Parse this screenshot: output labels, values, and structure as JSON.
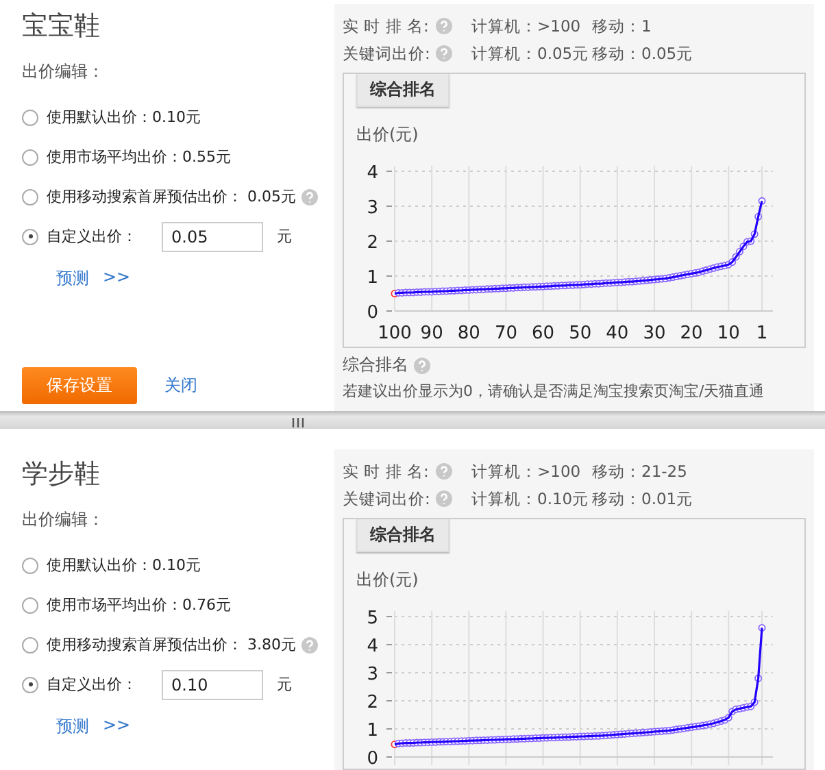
{
  "panels": [
    {
      "title": "宝宝鞋",
      "bid_label": "出价编辑：",
      "options": [
        {
          "kind": "preset",
          "label": "使用默认出价：0.10元",
          "selected": false,
          "help": false
        },
        {
          "kind": "preset",
          "label": "使用市场平均出价：0.55元",
          "selected": false,
          "help": false
        },
        {
          "kind": "preset",
          "label": "使用移动搜索首屏预估出价： 0.05元",
          "selected": false,
          "help": true
        },
        {
          "kind": "custom",
          "label": "自定义出价：",
          "value": "0.05",
          "unit": "元",
          "selected": true,
          "help": false
        }
      ],
      "forecast_link": "预测",
      "forecast_arrow": ">>",
      "save_button": "保存设置",
      "close_link": "关闭",
      "stats": [
        {
          "label": "实 时 排 名:",
          "computer": "计算机：>100",
          "mobile": "移动：1"
        },
        {
          "label": "关键词出价:",
          "computer": "计算机：0.05元",
          "mobile": "移动：0.05元"
        }
      ],
      "chart": {
        "tab": "综合排名",
        "y_title": "出价(元)",
        "chart_data": {
          "type": "line",
          "grid": true,
          "ylim": [
            0,
            4
          ],
          "yticks": [
            0,
            1,
            2,
            3,
            4
          ],
          "xlim": [
            100,
            1
          ],
          "xticks": [
            100,
            90,
            80,
            70,
            60,
            50,
            40,
            30,
            20,
            10,
            1
          ],
          "x": [
            100,
            99,
            98,
            97,
            96,
            95,
            94,
            93,
            92,
            91,
            90,
            89,
            88,
            87,
            86,
            85,
            84,
            83,
            82,
            81,
            80,
            79,
            78,
            77,
            76,
            75,
            74,
            73,
            72,
            71,
            70,
            69,
            68,
            67,
            66,
            65,
            64,
            63,
            62,
            61,
            60,
            59,
            58,
            57,
            56,
            55,
            54,
            53,
            52,
            51,
            50,
            49,
            48,
            47,
            46,
            45,
            44,
            43,
            42,
            41,
            40,
            39,
            38,
            37,
            36,
            35,
            34,
            33,
            32,
            31,
            30,
            29,
            28,
            27,
            26,
            25,
            24,
            23,
            22,
            21,
            20,
            19,
            18,
            17,
            16,
            15,
            14,
            13,
            12,
            11,
            10,
            9,
            8,
            7,
            6,
            5,
            4,
            3,
            2,
            1
          ],
          "series": [
            {
              "color": "#2200ff",
              "marker": "circle",
              "values": [
                0.5,
                0.52,
                0.52,
                0.53,
                0.53,
                0.53,
                0.54,
                0.54,
                0.55,
                0.55,
                0.55,
                0.56,
                0.56,
                0.57,
                0.57,
                0.58,
                0.58,
                0.59,
                0.59,
                0.6,
                0.6,
                0.61,
                0.61,
                0.62,
                0.62,
                0.63,
                0.63,
                0.64,
                0.64,
                0.65,
                0.65,
                0.66,
                0.66,
                0.67,
                0.67,
                0.68,
                0.68,
                0.69,
                0.69,
                0.7,
                0.7,
                0.71,
                0.71,
                0.72,
                0.72,
                0.73,
                0.73,
                0.74,
                0.74,
                0.75,
                0.75,
                0.76,
                0.77,
                0.77,
                0.78,
                0.78,
                0.79,
                0.8,
                0.8,
                0.81,
                0.82,
                0.82,
                0.83,
                0.84,
                0.84,
                0.85,
                0.86,
                0.87,
                0.88,
                0.89,
                0.9,
                0.91,
                0.92,
                0.93,
                0.95,
                0.97,
                0.99,
                1.01,
                1.03,
                1.05,
                1.07,
                1.09,
                1.11,
                1.14,
                1.17,
                1.2,
                1.23,
                1.26,
                1.28,
                1.3,
                1.33,
                1.4,
                1.55,
                1.7,
                1.85,
                1.98,
                2.0,
                2.2,
                2.7,
                3.15
              ]
            }
          ]
        }
      },
      "footer": {
        "heading": "综合排名",
        "note": "若建议出价显示为0，请确认是否满足淘宝搜索页淘宝/天猫直通"
      }
    },
    {
      "title": "学步鞋",
      "bid_label": "出价编辑：",
      "options": [
        {
          "kind": "preset",
          "label": "使用默认出价：0.10元",
          "selected": false,
          "help": false
        },
        {
          "kind": "preset",
          "label": "使用市场平均出价：0.76元",
          "selected": false,
          "help": false
        },
        {
          "kind": "preset",
          "label": "使用移动搜索首屏预估出价： 3.80元",
          "selected": false,
          "help": true
        },
        {
          "kind": "custom",
          "label": "自定义出价：",
          "value": "0.10",
          "unit": "元",
          "selected": true,
          "help": false
        }
      ],
      "forecast_link": "预测",
      "forecast_arrow": ">>",
      "stats": [
        {
          "label": "实 时 排 名:",
          "computer": "计算机：>100",
          "mobile": "移动：21-25"
        },
        {
          "label": "关键词出价:",
          "computer": "计算机：0.10元",
          "mobile": "移动：0.01元"
        }
      ],
      "chart": {
        "tab": "综合排名",
        "y_title": "出价(元)",
        "chart_data": {
          "type": "line",
          "grid": true,
          "ylim": [
            0,
            5
          ],
          "yticks": [
            0,
            1,
            2,
            3,
            4,
            5
          ],
          "xlim": [
            100,
            1
          ],
          "x": [
            100,
            99,
            98,
            97,
            96,
            95,
            94,
            93,
            92,
            91,
            90,
            89,
            88,
            87,
            86,
            85,
            84,
            83,
            82,
            81,
            80,
            79,
            78,
            77,
            76,
            75,
            74,
            73,
            72,
            71,
            70,
            69,
            68,
            67,
            66,
            65,
            64,
            63,
            62,
            61,
            60,
            59,
            58,
            57,
            56,
            55,
            54,
            53,
            52,
            51,
            50,
            49,
            48,
            47,
            46,
            45,
            44,
            43,
            42,
            41,
            40,
            39,
            38,
            37,
            36,
            35,
            34,
            33,
            32,
            31,
            30,
            29,
            28,
            27,
            26,
            25,
            24,
            23,
            22,
            21,
            20,
            19,
            18,
            17,
            16,
            15,
            14,
            13,
            12,
            11,
            10,
            9,
            8,
            7,
            6,
            5,
            4,
            3,
            2,
            1
          ],
          "series": [
            {
              "color": "#2200ff",
              "marker": "circle",
              "values": [
                0.45,
                0.48,
                0.49,
                0.5,
                0.5,
                0.5,
                0.51,
                0.51,
                0.52,
                0.52,
                0.53,
                0.53,
                0.54,
                0.54,
                0.55,
                0.55,
                0.56,
                0.56,
                0.57,
                0.57,
                0.58,
                0.58,
                0.59,
                0.59,
                0.6,
                0.6,
                0.61,
                0.61,
                0.62,
                0.62,
                0.63,
                0.63,
                0.64,
                0.64,
                0.65,
                0.65,
                0.66,
                0.66,
                0.67,
                0.67,
                0.68,
                0.68,
                0.69,
                0.69,
                0.7,
                0.7,
                0.71,
                0.71,
                0.72,
                0.72,
                0.73,
                0.73,
                0.74,
                0.74,
                0.75,
                0.75,
                0.76,
                0.77,
                0.78,
                0.79,
                0.8,
                0.81,
                0.82,
                0.83,
                0.84,
                0.85,
                0.86,
                0.87,
                0.88,
                0.89,
                0.9,
                0.91,
                0.92,
                0.93,
                0.94,
                0.96,
                0.98,
                1.0,
                1.02,
                1.04,
                1.06,
                1.08,
                1.1,
                1.12,
                1.14,
                1.17,
                1.2,
                1.24,
                1.28,
                1.32,
                1.4,
                1.62,
                1.7,
                1.72,
                1.75,
                1.78,
                1.8,
                1.95,
                2.8,
                4.6
              ]
            }
          ]
        }
      }
    }
  ]
}
